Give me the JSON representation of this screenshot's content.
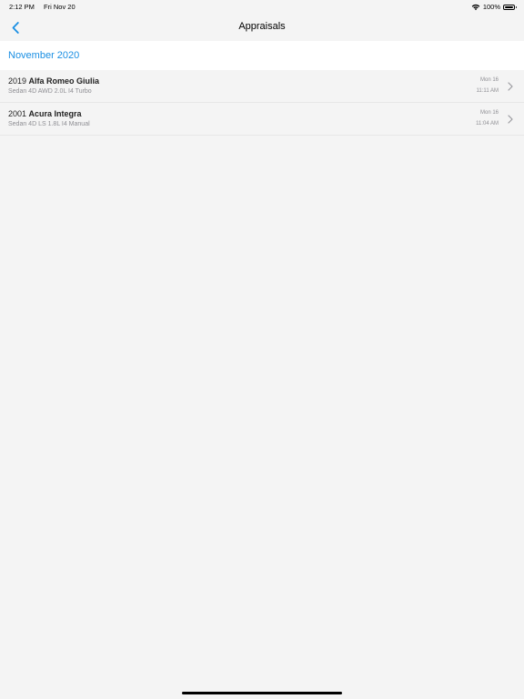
{
  "status": {
    "time": "2:12 PM",
    "date": "Fri Nov 20",
    "battery": "100%",
    "battery_level": 1.0
  },
  "nav": {
    "title": "Appraisals",
    "back_icon": "chevron-left-icon"
  },
  "section": {
    "title": "November 2020"
  },
  "appraisals": [
    {
      "year": "2019",
      "model": "Alfa Romeo Giulia",
      "trim": "Sedan 4D AWD 2.0L I4 Turbo",
      "date": "Mon 16",
      "time": "11:11 AM"
    },
    {
      "year": "2001",
      "model": "Acura Integra",
      "trim": "Sedan 4D LS 1.8L I4 Manual",
      "date": "Mon 16",
      "time": "11:04 AM"
    }
  ],
  "colors": {
    "accent": "#1a8fe3",
    "background": "#f4f4f4",
    "secondary_text": "#8e8e93"
  }
}
